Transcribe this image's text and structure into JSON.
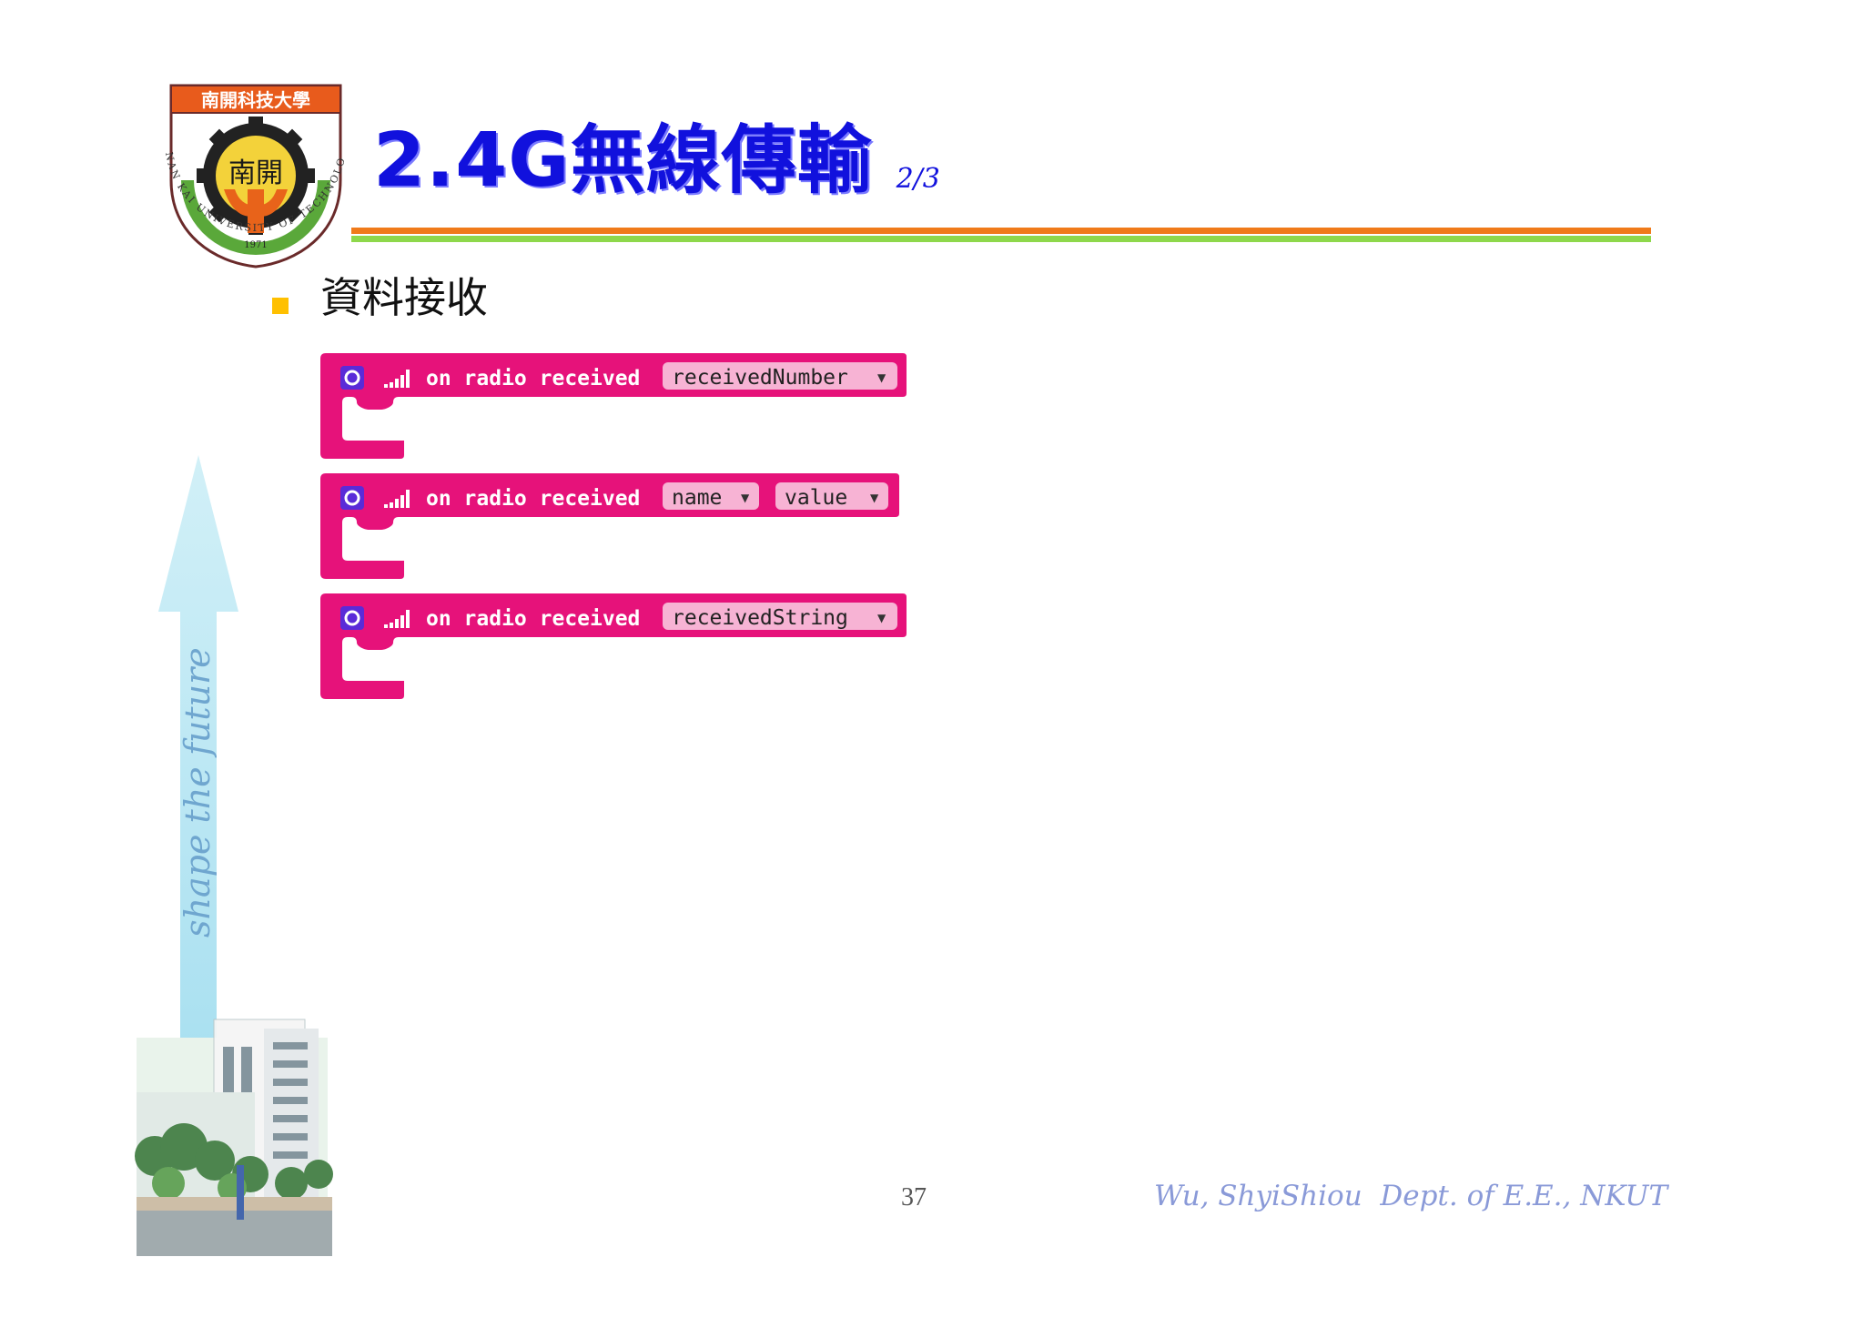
{
  "logo": {
    "banner_text": "南開科技大學",
    "center_text": "南開",
    "ring_text": "NAN KAI UNIVERSITY OF TECHNOLOGY",
    "year": "1971"
  },
  "title": {
    "main": "2.4G無線傳輸",
    "page": "2/3"
  },
  "bullet": {
    "text": "資料接收"
  },
  "blocks": [
    {
      "label": "on radio received",
      "params": [
        "receivedNumber"
      ]
    },
    {
      "label": "on radio received",
      "params": [
        "name",
        "value"
      ]
    },
    {
      "label": "on radio received",
      "params": [
        "receivedString"
      ]
    }
  ],
  "tagline": "shape the future",
  "footer": {
    "page_number": "37",
    "author": "Wu, ShyiShiou  Dept. of E.E., NKUT"
  },
  "colors": {
    "block": "#e6127a",
    "title": "#1111dd",
    "orange_rule": "#f07a1a",
    "green_rule": "#8ed84b",
    "bullet": "#ffc000"
  }
}
